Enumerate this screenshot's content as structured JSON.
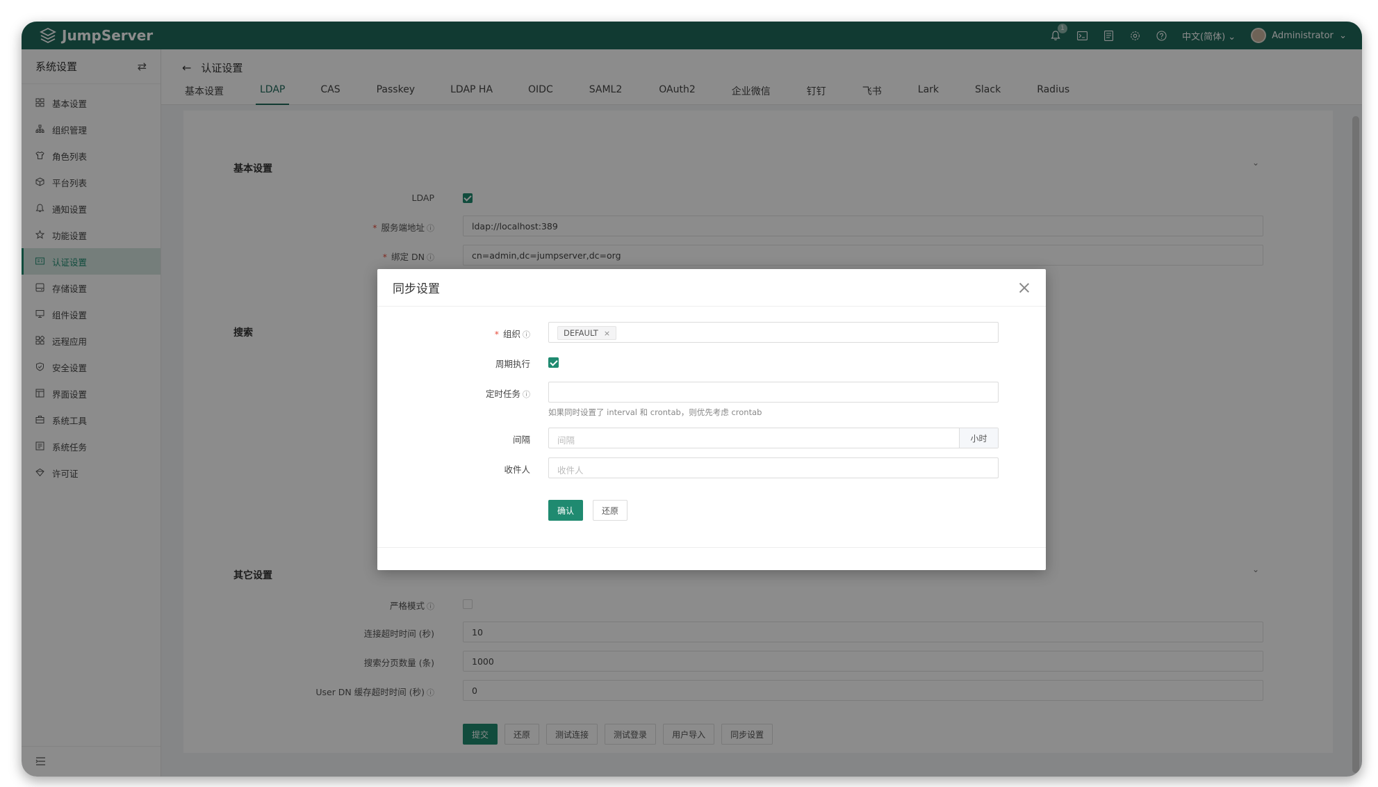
{
  "app": {
    "brand": "JumpServer"
  },
  "topbar": {
    "notification_count": "1",
    "language": "中文(简体)",
    "user": "Administrator"
  },
  "sidebar": {
    "title": "系统设置",
    "items": [
      {
        "label": "基本设置",
        "icon": "grid-icon"
      },
      {
        "label": "组织管理",
        "icon": "org-icon"
      },
      {
        "label": "角色列表",
        "icon": "shirt-icon"
      },
      {
        "label": "平台列表",
        "icon": "cube-icon"
      },
      {
        "label": "通知设置",
        "icon": "bell-icon"
      },
      {
        "label": "功能设置",
        "icon": "star-icon"
      },
      {
        "label": "认证设置",
        "icon": "id-card-icon",
        "active": true
      },
      {
        "label": "存储设置",
        "icon": "storage-icon"
      },
      {
        "label": "组件设置",
        "icon": "monitor-icon"
      },
      {
        "label": "远程应用",
        "icon": "apps-icon"
      },
      {
        "label": "安全设置",
        "icon": "shield-icon"
      },
      {
        "label": "界面设置",
        "icon": "layout-icon"
      },
      {
        "label": "系统工具",
        "icon": "toolbox-icon"
      },
      {
        "label": "系统任务",
        "icon": "task-icon"
      },
      {
        "label": "许可证",
        "icon": "license-icon"
      }
    ]
  },
  "page": {
    "title": "认证设置",
    "tabs": [
      "基本设置",
      "LDAP",
      "CAS",
      "Passkey",
      "LDAP HA",
      "OIDC",
      "SAML2",
      "OAuth2",
      "企业微信",
      "钉钉",
      "飞书",
      "Lark",
      "Slack",
      "Radius"
    ],
    "active_tab": "LDAP"
  },
  "form": {
    "basic_title": "基本设置",
    "ldap_label": "LDAP",
    "server_label": "服务端地址",
    "server_value": "ldap://localhost:389",
    "bind_dn_label": "绑定 DN",
    "bind_dn_value": "cn=admin,dc=jumpserver,dc=org",
    "search_title": "搜索",
    "other_title": "其它设置",
    "strict_label": "严格模式",
    "conn_timeout_label": "连接超时时间 (秒)",
    "conn_timeout_value": "10",
    "page_size_label": "搜索分页数量 (条)",
    "page_size_value": "1000",
    "cache_timeout_label": "User DN 缓存超时时间 (秒)",
    "cache_timeout_value": "0",
    "buttons": {
      "submit": "提交",
      "reset": "还原",
      "test_conn": "测试连接",
      "test_login": "测试登录",
      "import": "用户导入",
      "sync": "同步设置"
    }
  },
  "dialog": {
    "title": "同步设置",
    "org_label": "组织",
    "org_tag": "DEFAULT",
    "periodic_label": "周期执行",
    "crontab_label": "定时任务",
    "crontab_hint": "如果同时设置了 interval 和 crontab，则优先考虑 crontab",
    "interval_label": "间隔",
    "interval_placeholder": "间隔",
    "interval_unit": "小时",
    "recipients_label": "收件人",
    "recipients_placeholder": "收件人",
    "confirm": "确认",
    "reset": "还原"
  }
}
